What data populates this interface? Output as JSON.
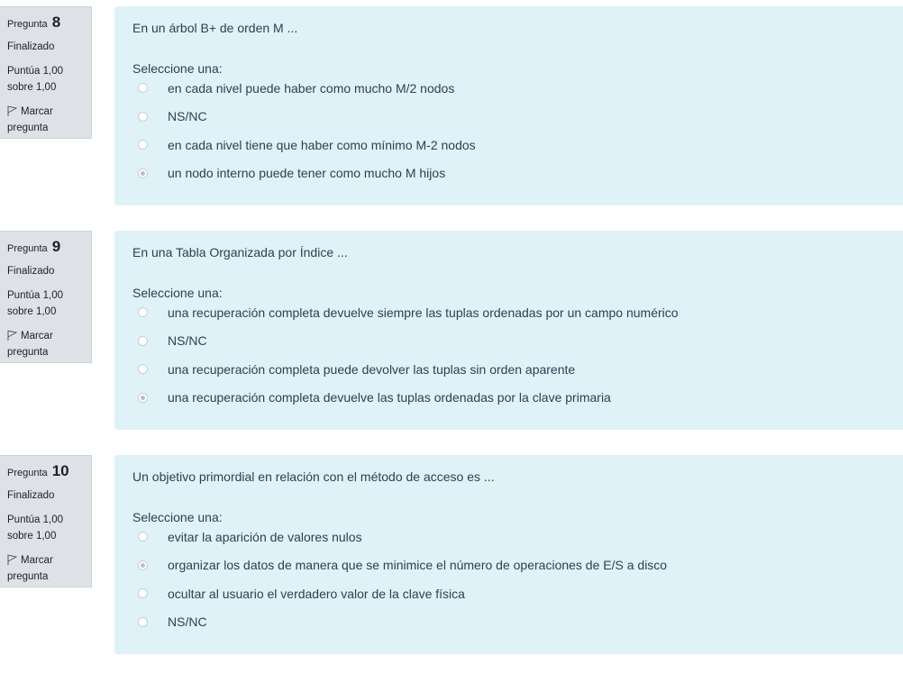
{
  "questions": [
    {
      "label": "Pregunta",
      "number": "8",
      "state": "Finalizado",
      "grade_line1": "Puntúa 1,00",
      "grade_line2": "sobre 1,00",
      "flag_line1": "Marcar",
      "flag_line2": "pregunta",
      "text": "En un árbol B+ de orden M ...",
      "prompt": "Seleccione una:",
      "answers": [
        {
          "text": "en cada nivel puede haber como mucho M/2 nodos",
          "checked": false
        },
        {
          "text": "NS/NC",
          "checked": false
        },
        {
          "text": "en cada nivel tiene que haber como mínimo M-2 nodos",
          "checked": false
        },
        {
          "text": "un nodo interno puede tener como mucho M hijos",
          "checked": true
        }
      ]
    },
    {
      "label": "Pregunta",
      "number": "9",
      "state": "Finalizado",
      "grade_line1": "Puntúa 1,00",
      "grade_line2": "sobre 1,00",
      "flag_line1": "Marcar",
      "flag_line2": "pregunta",
      "text": "En una Tabla Organizada por Índice ...",
      "prompt": "Seleccione una:",
      "answers": [
        {
          "text": "una recuperación completa devuelve siempre las tuplas ordenadas por un campo numérico",
          "checked": false
        },
        {
          "text": "NS/NC",
          "checked": false
        },
        {
          "text": "una recuperación completa puede devolver las tuplas sin orden aparente",
          "checked": false
        },
        {
          "text": "una recuperación completa devuelve las tuplas ordenadas por la clave primaria",
          "checked": true
        }
      ]
    },
    {
      "label": "Pregunta",
      "number": "10",
      "state": "Finalizado",
      "grade_line1": "Puntúa 1,00",
      "grade_line2": "sobre 1,00",
      "flag_line1": "Marcar",
      "flag_line2": "pregunta",
      "text": "Un objetivo primordial en relación con el método de acceso es ...",
      "prompt": "Seleccione una:",
      "answers": [
        {
          "text": "evitar la aparición de valores nulos",
          "checked": false
        },
        {
          "text": "organizar los datos de manera que se minimice el número de operaciones de E/S a disco",
          "checked": true
        },
        {
          "text": "ocultar al usuario el verdadero valor de la clave física",
          "checked": false
        },
        {
          "text": "NS/NC",
          "checked": false
        }
      ]
    }
  ]
}
